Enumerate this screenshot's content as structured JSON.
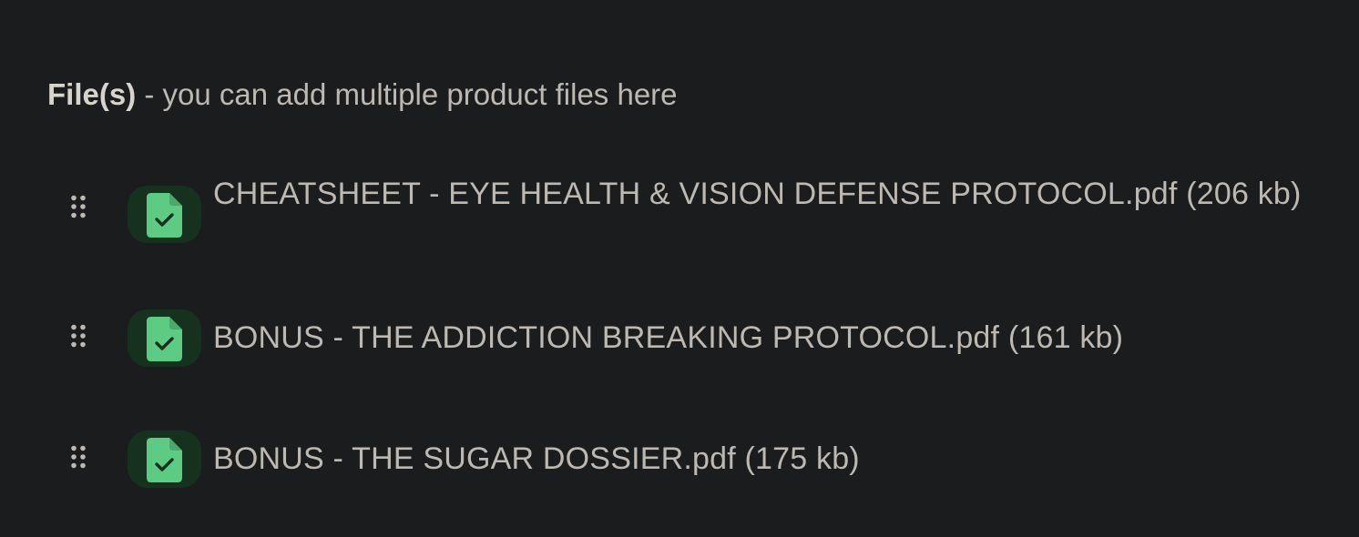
{
  "section": {
    "label_strong": "File(s)",
    "label_rest": " - you can add multiple product files here"
  },
  "files": [
    {
      "name": "CHEATSHEET - EYE HEALTH & VISION DEFENSE PROTOCOL.pdf (206 kb)",
      "status": "uploaded"
    },
    {
      "name": "BONUS - THE ADDICTION BREAKING PROTOCOL.pdf (161 kb)",
      "status": "uploaded"
    },
    {
      "name": "BONUS - THE SUGAR DOSSIER.pdf (175 kb)",
      "status": "uploaded"
    }
  ],
  "icons": {
    "drag": "drag-handle-icon",
    "file": "file-check-icon"
  },
  "colors": {
    "background": "#1b1c1e",
    "text": "#bdb8b1",
    "heading": "#d7d3cd",
    "badge_bg": "#16321f",
    "file_icon": "#5ecb84",
    "check": "#16321f",
    "handle": "#bdb8b1"
  }
}
